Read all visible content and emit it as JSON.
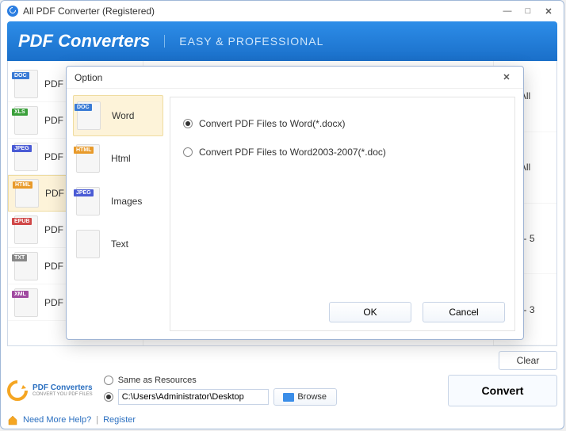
{
  "window": {
    "title": "All PDF Converter (Registered)"
  },
  "header": {
    "brand": "PDF Converters",
    "tagline": "EASY & PROFESSIONAL"
  },
  "types": [
    {
      "badge": "DOC",
      "label": "PDF to",
      "badgeClass": "b-doc"
    },
    {
      "badge": "XLS",
      "label": "PDF to",
      "badgeClass": "b-xls"
    },
    {
      "badge": "JPEG",
      "label": "PDF to",
      "badgeClass": "b-jpg"
    },
    {
      "badge": "HTML",
      "label": "PDF to",
      "badgeClass": "b-html",
      "selected": true
    },
    {
      "badge": "EPUB",
      "label": "PDF to",
      "badgeClass": "b-epub"
    },
    {
      "badge": "TXT",
      "label": "PDF to",
      "badgeClass": "b-txt"
    },
    {
      "badge": "XML",
      "label": "PDF to",
      "badgeClass": "b-xml"
    }
  ],
  "pages_col": [
    "All",
    "All",
    "2 - 5",
    "1 - 3"
  ],
  "buttons": {
    "clear": "Clear",
    "convert": "Convert",
    "browse": "Browse",
    "ok": "OK",
    "cancel": "Cancel"
  },
  "dest": {
    "same_label": "Same as Resources",
    "path": "C:\\Users\\Administrator\\Desktop"
  },
  "status": {
    "help": "Need More Help?",
    "register": "Register"
  },
  "logo": {
    "line1": "PDF Converters",
    "line2": "CONVERT YOU PDF FILES"
  },
  "modal": {
    "title": "Option",
    "tabs": [
      {
        "badge": "DOC",
        "label": "Word",
        "badgeClass": "b-doc",
        "selected": true
      },
      {
        "badge": "HTML",
        "label": "Html",
        "badgeClass": "b-html"
      },
      {
        "badge": "JPEG",
        "label": "Images",
        "badgeClass": "b-jpg"
      },
      {
        "badge": "",
        "label": "Text",
        "badgeClass": ""
      }
    ],
    "options": [
      {
        "label": "Convert PDF Files to Word(*.docx)",
        "checked": true
      },
      {
        "label": "Convert PDF Files to Word2003-2007(*.doc)",
        "checked": false
      }
    ]
  }
}
